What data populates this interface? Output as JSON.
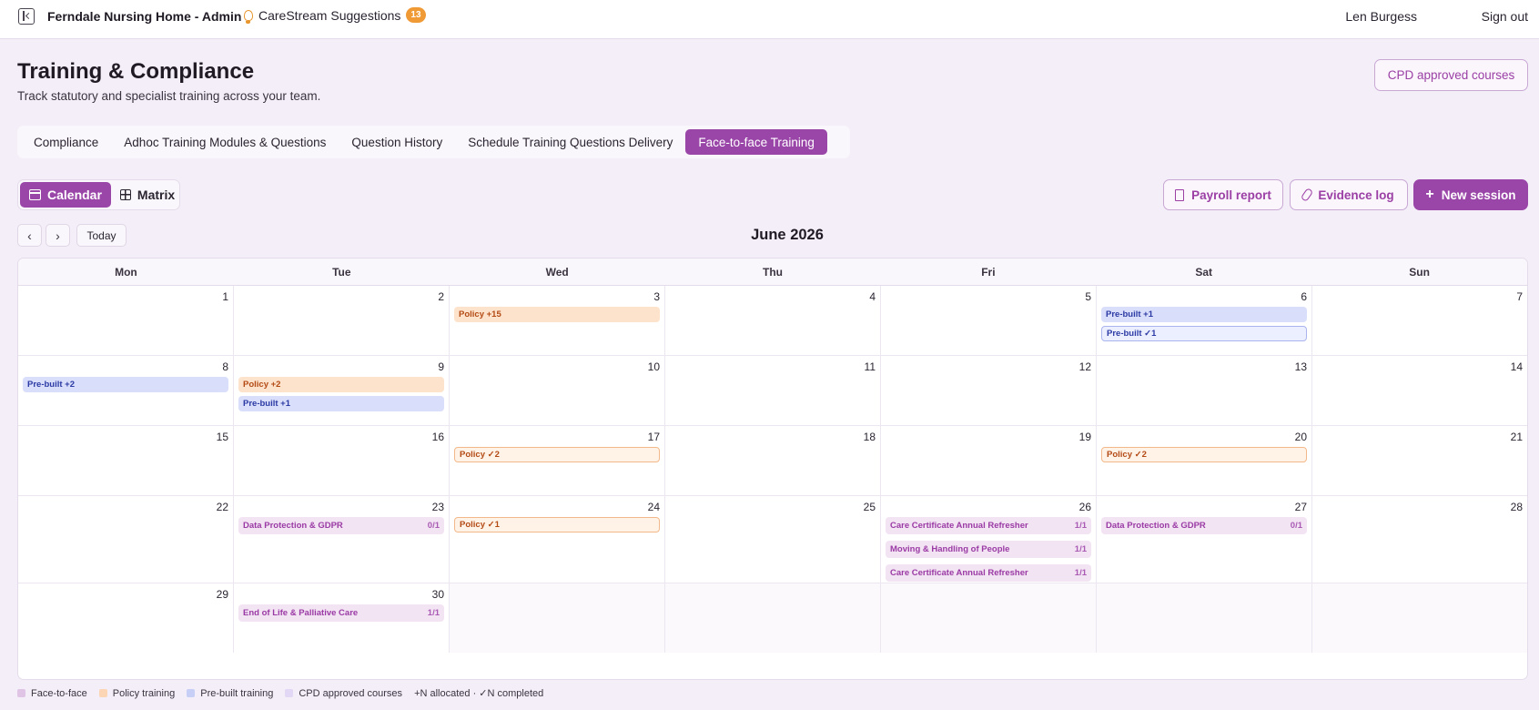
{
  "topbar": {
    "title": "Ferndale Nursing Home - Admin",
    "suggestions_label": "CareStream Suggestions",
    "suggestions_count": "13",
    "user": "Len Burgess",
    "sign_out": "Sign out"
  },
  "header": {
    "title": "Training & Compliance",
    "subtitle": "Track statutory and specialist training across your team.",
    "cpd_button": "CPD approved courses"
  },
  "tabs": [
    {
      "label": "Compliance",
      "active": false
    },
    {
      "label": "Adhoc Training Modules & Questions",
      "active": false
    },
    {
      "label": "Question History",
      "active": false
    },
    {
      "label": "Schedule Training Questions Delivery",
      "active": false
    },
    {
      "label": "Face-to-face Training",
      "active": true
    }
  ],
  "view_toggle": {
    "calendar": "Calendar",
    "matrix": "Matrix",
    "selected": "Calendar"
  },
  "actions": {
    "payroll": "Payroll report",
    "evidence": "Evidence log",
    "new_session": "New session"
  },
  "nav": {
    "prev": "‹",
    "next": "›",
    "today": "Today",
    "month": "June 2026"
  },
  "calendar": {
    "weekdays": [
      "Mon",
      "Tue",
      "Wed",
      "Thu",
      "Fri",
      "Sat",
      "Sun"
    ],
    "weeks": [
      [
        {
          "day": "1",
          "events": []
        },
        {
          "day": "2",
          "events": []
        },
        {
          "day": "3",
          "events": [
            {
              "type": "policy",
              "label": "Policy +15"
            }
          ]
        },
        {
          "day": "4",
          "events": []
        },
        {
          "day": "5",
          "events": []
        },
        {
          "day": "6",
          "events": [
            {
              "type": "prebuilt",
              "label": "Pre-built +1"
            },
            {
              "type": "prebuilt done",
              "label": "Pre-built ✓1"
            }
          ]
        },
        {
          "day": "7",
          "events": []
        }
      ],
      [
        {
          "day": "8",
          "events": [
            {
              "type": "prebuilt",
              "label": "Pre-built +2"
            }
          ]
        },
        {
          "day": "9",
          "events": [
            {
              "type": "policy",
              "label": "Policy +2"
            },
            {
              "type": "prebuilt",
              "label": "Pre-built +1"
            }
          ]
        },
        {
          "day": "10",
          "events": []
        },
        {
          "day": "11",
          "events": []
        },
        {
          "day": "12",
          "events": []
        },
        {
          "day": "13",
          "events": []
        },
        {
          "day": "14",
          "events": []
        }
      ],
      [
        {
          "day": "15",
          "events": []
        },
        {
          "day": "16",
          "events": []
        },
        {
          "day": "17",
          "events": [
            {
              "type": "policy done",
              "label": "Policy ✓2"
            }
          ]
        },
        {
          "day": "18",
          "events": []
        },
        {
          "day": "19",
          "events": []
        },
        {
          "day": "20",
          "events": [
            {
              "type": "policy done",
              "label": "Policy ✓2"
            }
          ]
        },
        {
          "day": "21",
          "events": []
        }
      ],
      [
        {
          "day": "22",
          "events": []
        },
        {
          "day": "23",
          "events": [
            {
              "type": "f2f",
              "label": "Data Protection & GDPR",
              "count": "0/1"
            }
          ]
        },
        {
          "day": "24",
          "events": [
            {
              "type": "policy done",
              "label": "Policy ✓1"
            }
          ]
        },
        {
          "day": "25",
          "events": []
        },
        {
          "day": "26",
          "events": [
            {
              "type": "f2f",
              "label": "Care Certificate Annual Refresher",
              "count": "1/1"
            },
            {
              "type": "f2f",
              "label": "Moving & Handling of People",
              "count": "1/1"
            },
            {
              "type": "f2f",
              "label": "Care Certificate Annual Refresher",
              "count": "1/1"
            }
          ]
        },
        {
          "day": "27",
          "events": [
            {
              "type": "f2f",
              "label": "Data Protection & GDPR",
              "count": "0/1"
            }
          ]
        },
        {
          "day": "28",
          "events": []
        }
      ],
      [
        {
          "day": "29",
          "events": []
        },
        {
          "day": "30",
          "events": [
            {
              "type": "f2f",
              "label": "End of Life & Palliative Care",
              "count": "1/1"
            }
          ]
        },
        {
          "day": "",
          "events": []
        },
        {
          "day": "",
          "events": []
        },
        {
          "day": "",
          "events": []
        },
        {
          "day": "",
          "events": []
        },
        {
          "day": "",
          "events": []
        }
      ]
    ]
  },
  "legend": [
    {
      "label": "Face-to-face",
      "color": "#e0c4e6"
    },
    {
      "label": "Policy training",
      "color": "#fcd6b4"
    },
    {
      "label": "Pre-built training",
      "color": "#c7cff6"
    },
    {
      "label": "CPD approved courses",
      "color": "#e2d7f4"
    }
  ],
  "legend_note": "+N allocated · ✓N completed"
}
